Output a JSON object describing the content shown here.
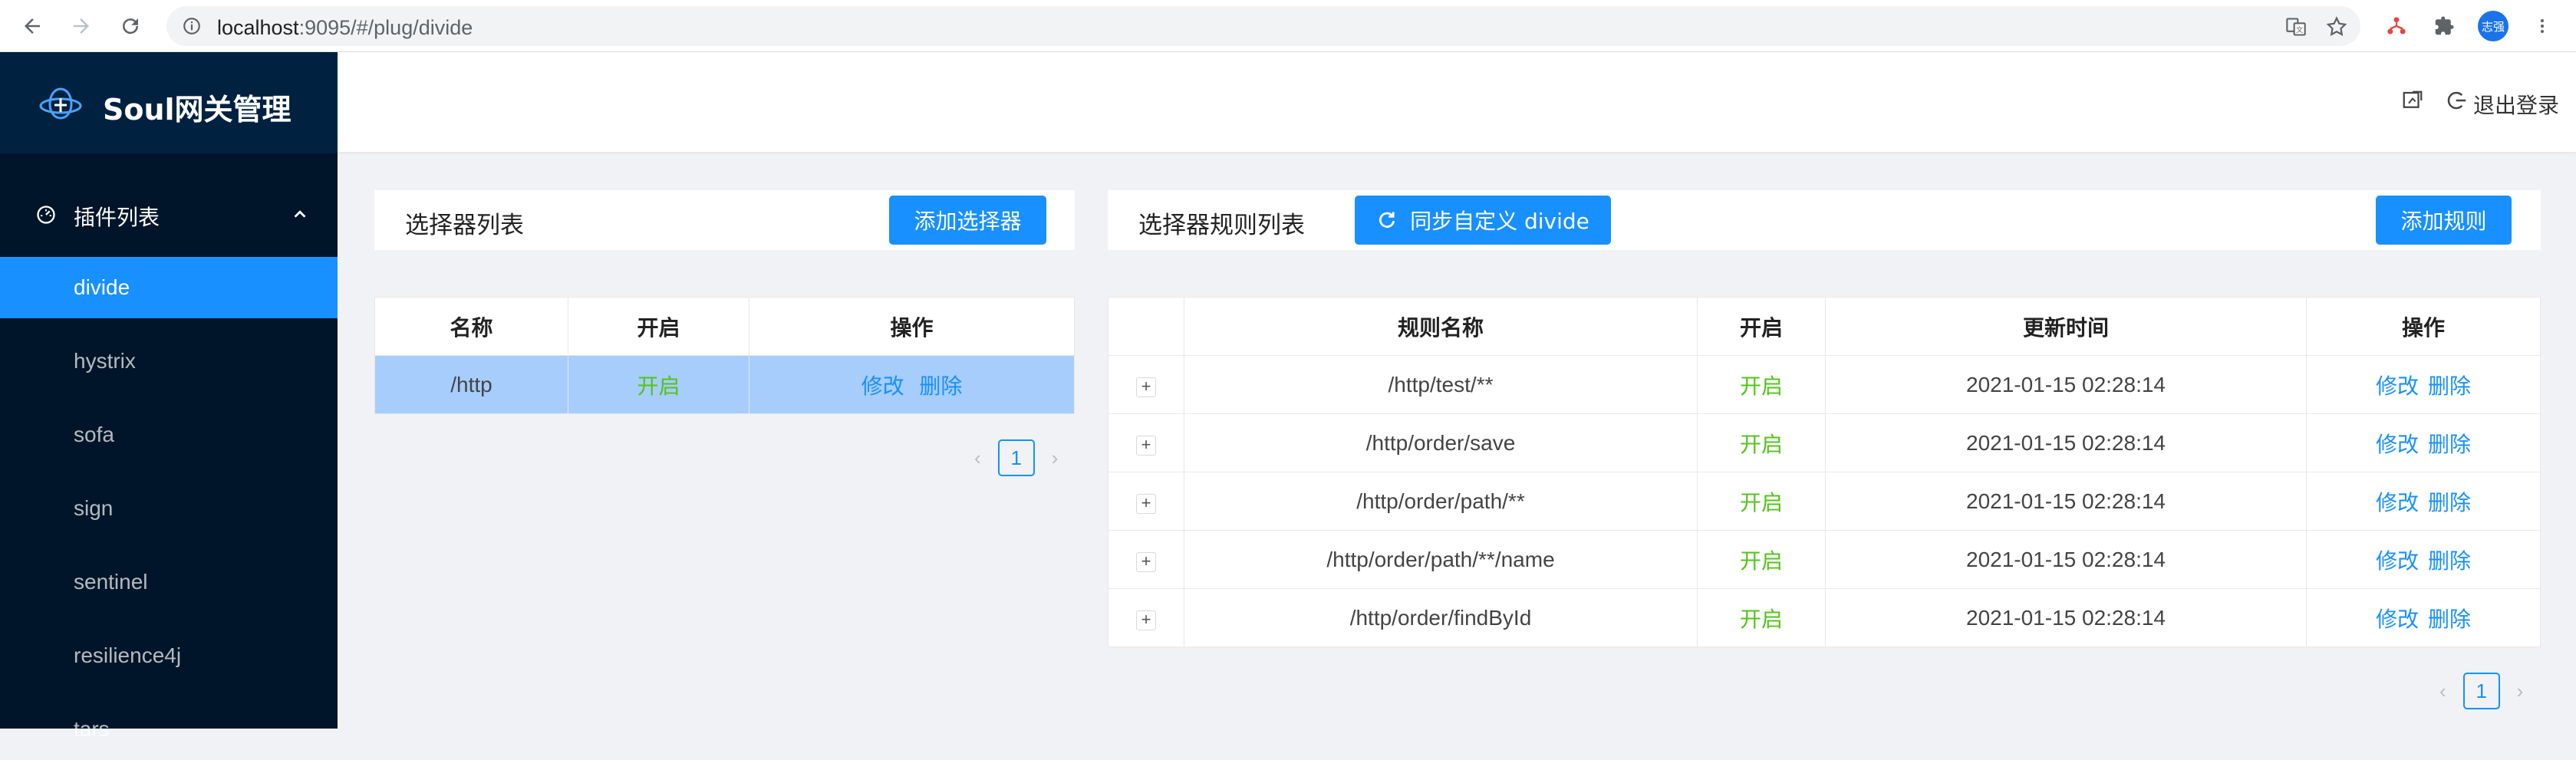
{
  "browser": {
    "url_host": "localhost",
    "url_rest": ":9095/#/plug/divide",
    "profile_label": "志强"
  },
  "sidebar": {
    "title": "Soul网关管理",
    "group_label": "插件列表",
    "items": [
      {
        "label": "divide",
        "active": true
      },
      {
        "label": "hystrix"
      },
      {
        "label": "sofa"
      },
      {
        "label": "sign"
      },
      {
        "label": "sentinel"
      },
      {
        "label": "resilience4j"
      },
      {
        "label": "tars"
      }
    ]
  },
  "header": {
    "logout_label": "退出登录"
  },
  "selector_panel": {
    "title": "选择器列表",
    "add_button": "添加选择器",
    "columns": [
      "名称",
      "开启",
      "操作"
    ],
    "rows": [
      {
        "name": "/http",
        "enabled": "开启",
        "edit": "修改",
        "delete": "删除"
      }
    ],
    "page": "1"
  },
  "rule_panel": {
    "title": "选择器规则列表",
    "sync_button": "同步自定义 divide",
    "add_button": "添加规则",
    "columns": [
      "",
      "规则名称",
      "开启",
      "更新时间",
      "操作"
    ],
    "rows": [
      {
        "expand": "+",
        "name": "/http/test/**",
        "enabled": "开启",
        "updated": "2021-01-15 02:28:14",
        "edit": "修改",
        "delete": "删除"
      },
      {
        "expand": "+",
        "name": "/http/order/save",
        "enabled": "开启",
        "updated": "2021-01-15 02:28:14",
        "edit": "修改",
        "delete": "删除"
      },
      {
        "expand": "+",
        "name": "/http/order/path/**",
        "enabled": "开启",
        "updated": "2021-01-15 02:28:14",
        "edit": "修改",
        "delete": "删除"
      },
      {
        "expand": "+",
        "name": "/http/order/path/**/name",
        "enabled": "开启",
        "updated": "2021-01-15 02:28:14",
        "edit": "修改",
        "delete": "删除"
      },
      {
        "expand": "+",
        "name": "/http/order/findById",
        "enabled": "开启",
        "updated": "2021-01-15 02:28:14",
        "edit": "修改",
        "delete": "删除"
      }
    ],
    "page": "1"
  },
  "colors": {
    "primary": "#1890ff",
    "sidebar_bg": "#001529",
    "enabled_green": "#52c41a",
    "selected_row": "#a6cdfb"
  }
}
